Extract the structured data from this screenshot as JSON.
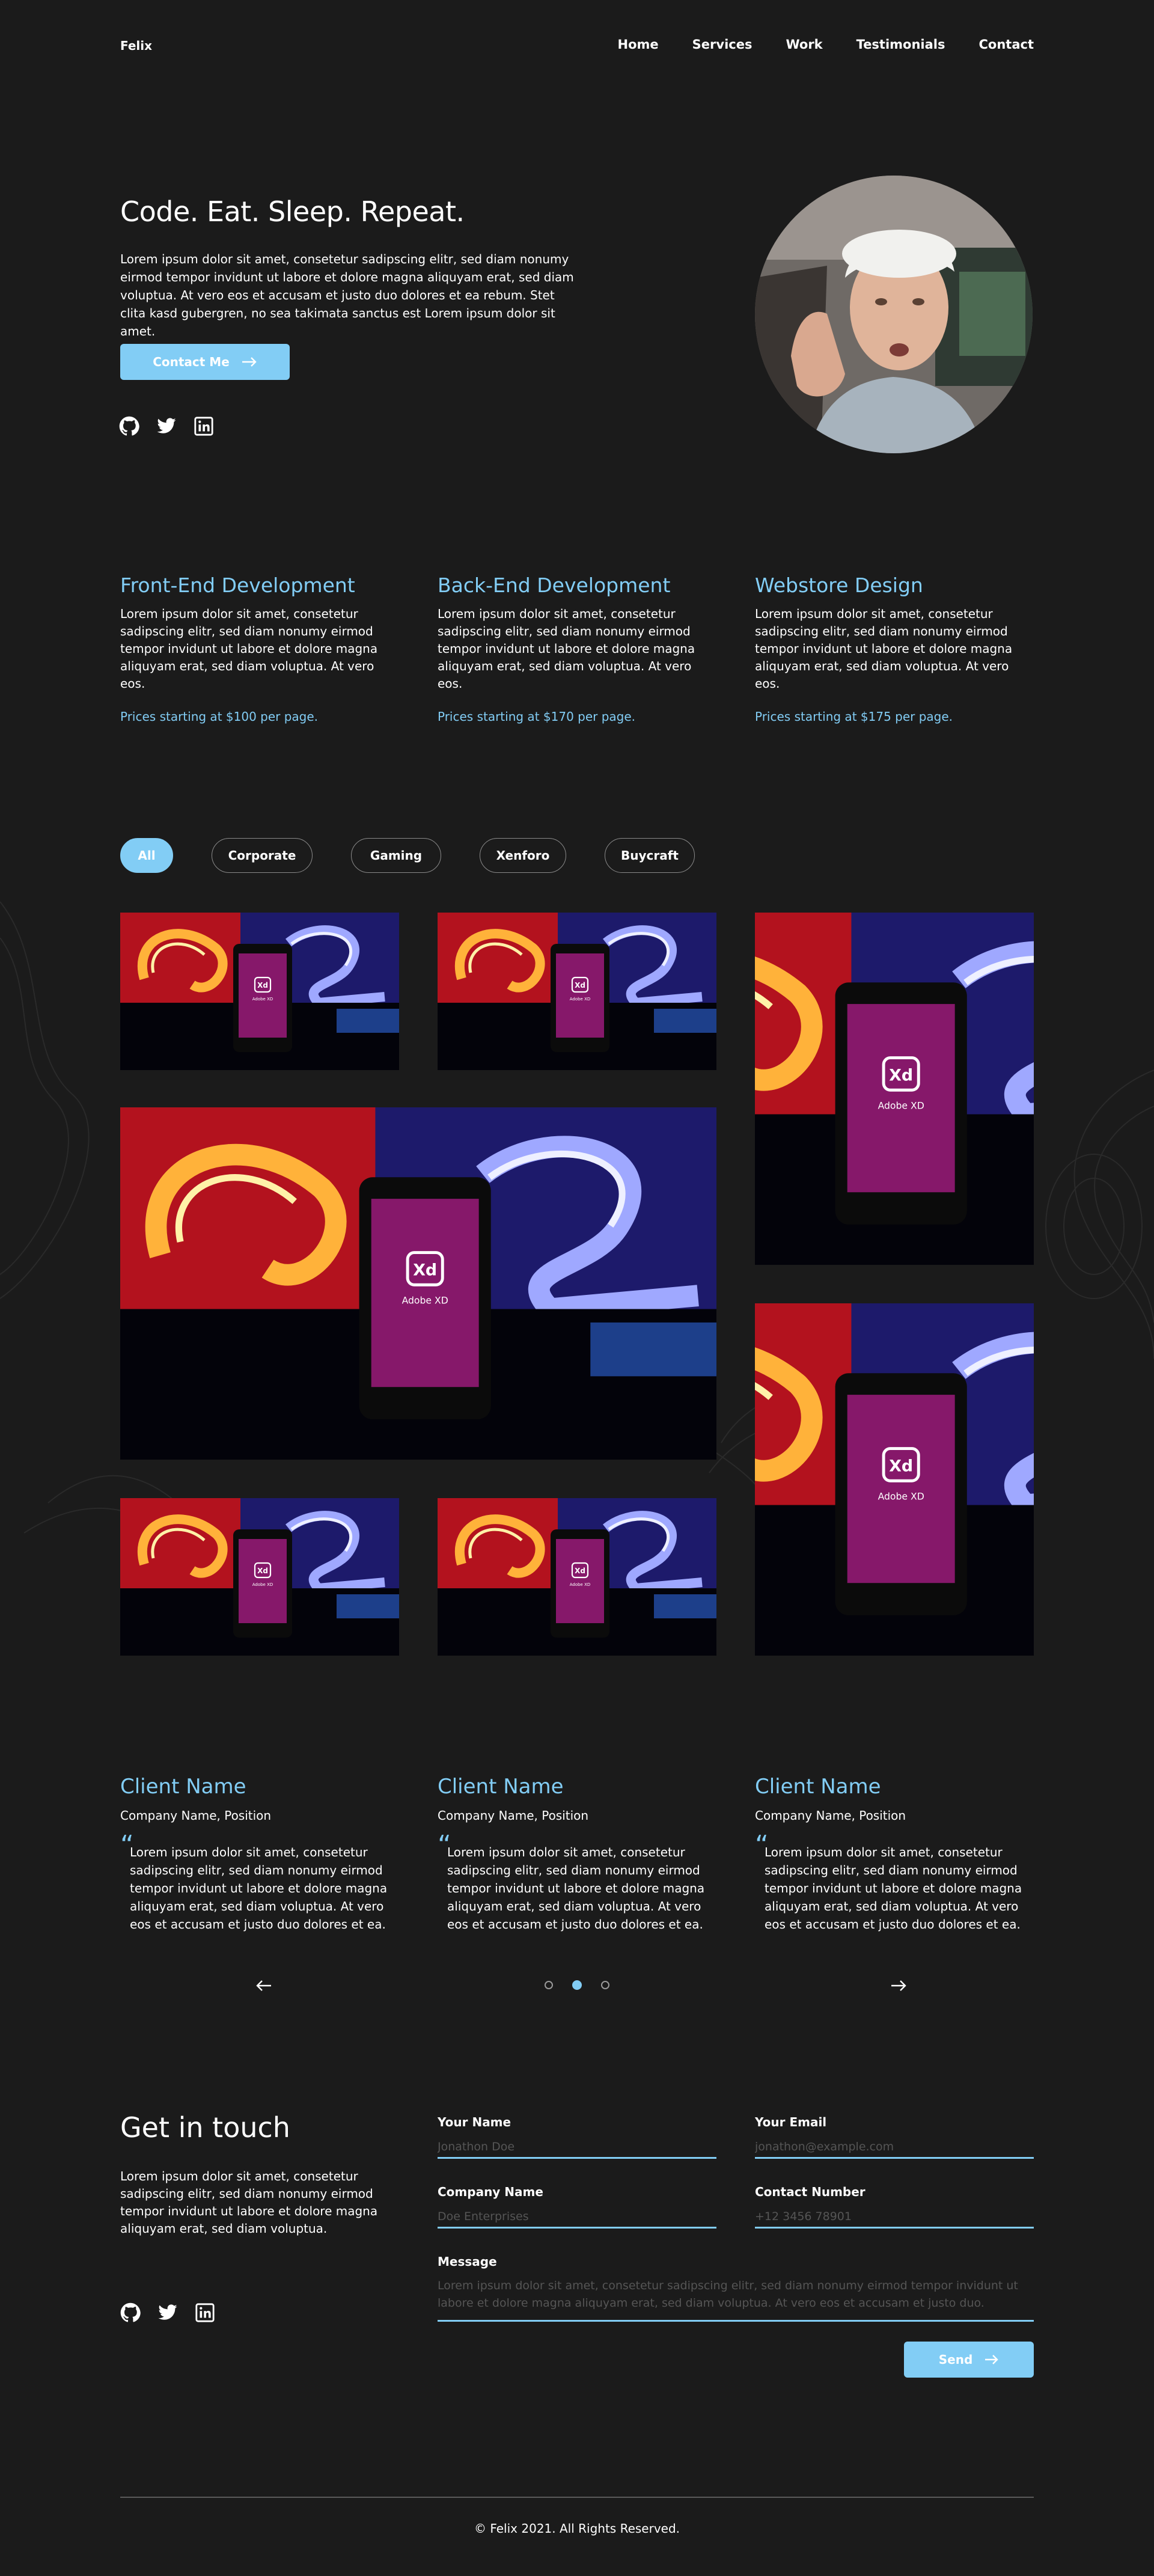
{
  "brand": "Felix",
  "nav": {
    "items": [
      "Home",
      "Services",
      "Work",
      "Testimonials",
      "Contact"
    ]
  },
  "hero": {
    "title": "Code. Eat. Sleep. Repeat.",
    "text": "Lorem ipsum dolor sit amet, consetetur sadipscing elitr, sed diam nonumy eirmod tempor invidunt ut labore et dolore magna aliquyam erat, sed diam voluptua. At vero eos et accusam et justo duo dolores et ea rebum. Stet clita kasd gubergren, no sea takimata sanctus est Lorem ipsum dolor sit amet.",
    "button_label": "Contact Me",
    "socials": [
      "github-icon",
      "twitter-icon",
      "linkedin-icon"
    ]
  },
  "services": [
    {
      "title": "Front-End Development",
      "text": "Lorem ipsum dolor sit amet, consetetur sadipscing elitr, sed diam nonumy eirmod tempor invidunt ut labore et dolore magna aliquyam erat, sed diam voluptua. At vero eos.",
      "price": "Prices starting at $100 per page."
    },
    {
      "title": "Back-End Development",
      "text": "Lorem ipsum dolor sit amet, consetetur sadipscing elitr, sed diam nonumy eirmod tempor invidunt ut labore et dolore magna aliquyam erat, sed diam voluptua. At vero eos.",
      "price": "Prices starting at $170 per page."
    },
    {
      "title": "Webstore Design",
      "text": "Lorem ipsum dolor sit amet, consetetur sadipscing elitr, sed diam nonumy eirmod tempor invidunt ut labore et dolore magna aliquyam erat, sed diam voluptua. At vero eos.",
      "price": "Prices starting at $175 per page."
    }
  ],
  "work": {
    "filters": [
      "All",
      "Corporate",
      "Gaming",
      "Xenforo",
      "Buycraft"
    ],
    "active_filter": "All",
    "tile_caption": "Adobe XD",
    "tile_logo": "Xd"
  },
  "testimonials": [
    {
      "name": "Client Name",
      "role": "Company Name, Position",
      "quote": "Lorem ipsum dolor sit amet, consetetur sadipscing elitr, sed diam nonumy eirmod tempor invidunt ut labore et dolore magna aliquyam erat, sed diam voluptua. At vero eos et accusam et justo duo dolores et ea."
    },
    {
      "name": "Client Name",
      "role": "Company Name, Position",
      "quote": "Lorem ipsum dolor sit amet, consetetur sadipscing elitr, sed diam nonumy eirmod tempor invidunt ut labore et dolore magna aliquyam erat, sed diam voluptua. At vero eos et accusam et justo duo dolores et ea."
    },
    {
      "name": "Client Name",
      "role": "Company Name, Position",
      "quote": "Lorem ipsum dolor sit amet, consetetur sadipscing elitr, sed diam nonumy eirmod tempor invidunt ut labore et dolore magna aliquyam erat, sed diam voluptua. At vero eos et accusam et justo duo dolores et ea."
    }
  ],
  "carousel": {
    "prev_icon": "arrow-left-icon",
    "next_icon": "arrow-right-icon",
    "active_dot": 2,
    "dot_count": 3
  },
  "contact": {
    "title": "Get in touch",
    "text": "Lorem ipsum dolor sit amet, consetetur sadipscing elitr, sed diam nonumy eirmod tempor invidunt ut labore et dolore magna aliquyam erat, sed diam voluptua.",
    "name_label": "Your Name",
    "name_placeholder": "Jonathon Doe",
    "email_label": "Your Email",
    "email_placeholder": "jonathon@example.com",
    "company_label": "Company Name",
    "company_placeholder": "Doe Enterprises",
    "phone_label": "Contact Number",
    "phone_placeholder": "+12 3456 78901",
    "message_label": "Message",
    "message_placeholder": "Lorem ipsum dolor sit amet, consetetur sadipscing elitr, sed diam nonumy eirmod tempor invidunt ut labore et dolore magna aliquyam erat, sed diam voluptua. At vero eos et accusam et justo duo.",
    "send_label": "Send"
  },
  "footer": {
    "text": "©  Felix 2021. All Rights Reserved."
  },
  "colors": {
    "accent": "#82cdf5",
    "background": "#1b1b1b",
    "text": "#ffffff"
  }
}
